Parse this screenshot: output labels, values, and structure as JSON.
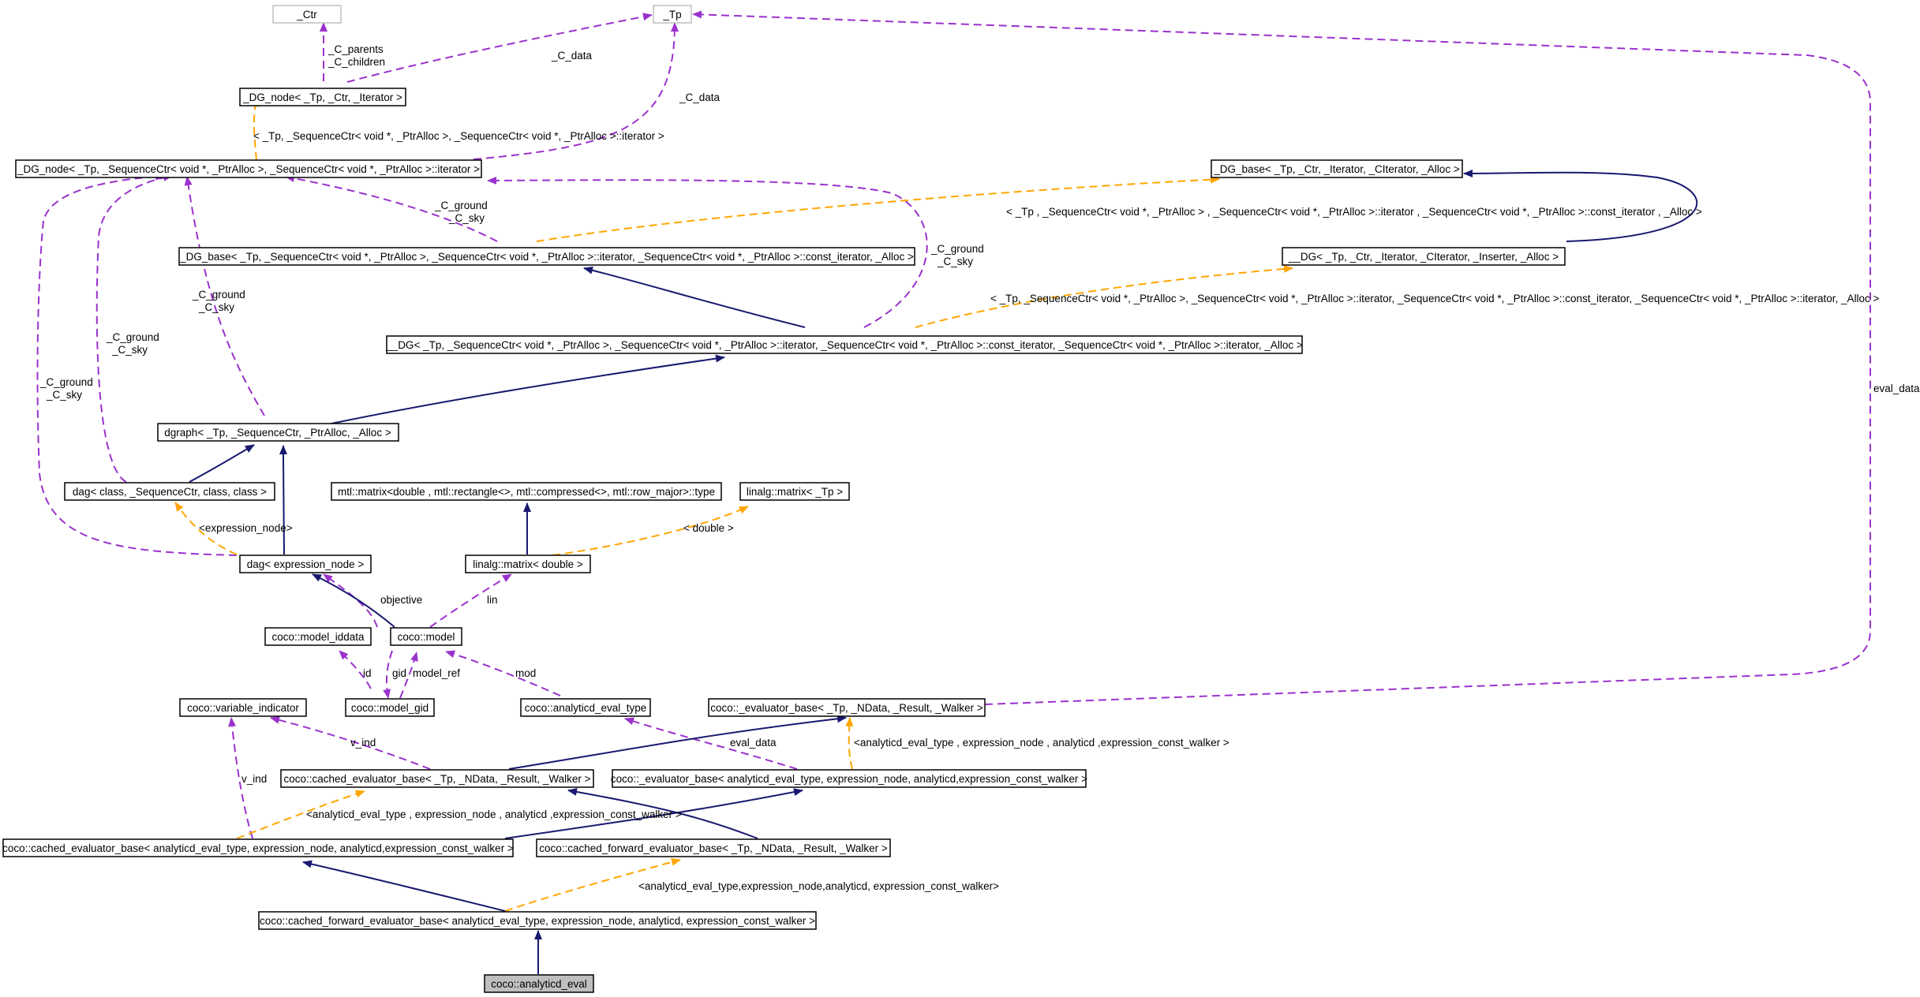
{
  "nodes": {
    "ctr": "_Ctr",
    "tp": "_Tp",
    "dg_node_generic": "_DG_node< _Tp, _Ctr, _Iterator >",
    "dg_node_inst": "_DG_node< _Tp, _SequenceCtr< void *, _PtrAlloc >, _SequenceCtr< void *, _PtrAlloc >::iterator >",
    "dg_base_generic": "_DG_base< _Tp, _Ctr, _Iterator, _CIterator, _Alloc >",
    "dg_base_inst": "_DG_base< _Tp, _SequenceCtr< void *, _PtrAlloc >, _SequenceCtr< void *, _PtrAlloc >::iterator, _SequenceCtr< void *, _PtrAlloc >::const_iterator, _Alloc >",
    "dg_generic": "__DG< _Tp, _Ctr, _Iterator, _CIterator, _Inserter, _Alloc >",
    "dg_inst": "__DG< _Tp, _SequenceCtr< void *, _PtrAlloc >, _SequenceCtr< void *, _PtrAlloc >::iterator, _SequenceCtr< void *, _PtrAlloc >::const_iterator, _SequenceCtr< void *, _PtrAlloc >::iterator, _Alloc >",
    "dgraph": "dgraph< _Tp, _SequenceCtr, _PtrAlloc, _Alloc >",
    "dag_generic": "dag< class, _SequenceCtr, class, class >",
    "dag_expr": "dag< expression_node >",
    "mtl_matrix": "mtl::matrix<double , mtl::rectangle<>, mtl::compressed<>, mtl::row_major>::type",
    "linalg_matrix_tp": "linalg::matrix< _Tp >",
    "linalg_matrix_double": "linalg::matrix< double >",
    "model_iddata": "coco::model_iddata",
    "model": "coco::model",
    "model_gid": "coco::model_gid",
    "analyticd_eval_type": "coco::analyticd_eval_type",
    "evaluator_base_generic": "coco::_evaluator_base< _Tp, _NData, _Result, _Walker >",
    "variable_indicator": "coco::variable_indicator",
    "cached_evaluator_base_generic": "coco::cached_evaluator_base< _Tp, _NData, _Result, _Walker >",
    "evaluator_base_inst": "coco::_evaluator_base< analyticd_eval_type, expression_node, analyticd,expression_const_walker >",
    "cached_evaluator_base_inst": "coco::cached_evaluator_base< analyticd_eval_type, expression_node, analyticd,expression_const_walker >",
    "cached_forward_generic": "coco::cached_forward_evaluator_base< _Tp, _NData, _Result, _Walker >",
    "cached_forward_inst": "coco::cached_forward_evaluator_base< analyticd_eval_type, expression_node, analyticd, expression_const_walker >",
    "analyticd_eval": "coco::analyticd_eval"
  },
  "edge_labels": {
    "c_parents": "_C_parents",
    "c_children": "_C_children",
    "c_data_1": "_C_data",
    "c_data_2": "_C_data",
    "tpl_dg_node": "< _Tp, _SequenceCtr< void *, _PtrAlloc >, _SequenceCtr< void *, _PtrAlloc >::iterator >",
    "tpl_dg_base": "< _Tp , _SequenceCtr< void *, _PtrAlloc > , _SequenceCtr< void *, _PtrAlloc >::iterator , _SequenceCtr< void *, _PtrAlloc >::const_iterator , _Alloc  >",
    "tpl_dg": "< _Tp, _SequenceCtr< void *, _PtrAlloc >, _SequenceCtr< void *, _PtrAlloc >::iterator, _SequenceCtr< void *, _PtrAlloc >::const_iterator, _SequenceCtr< void *, _PtrAlloc >::iterator, _Alloc >",
    "ground_sky_a1": "_C_ground",
    "ground_sky_a2": "_C_sky",
    "ground_sky_b1": "_C_ground",
    "ground_sky_b2": "_C_sky",
    "ground_sky_c1": "_C_ground",
    "ground_sky_c2": "_C_sky",
    "ground_sky_d1": "_C_ground",
    "ground_sky_d2": "_C_sky",
    "ground_sky_e1": "_C_ground",
    "ground_sky_e2": "_C_sky",
    "eval_data_right": "eval_data",
    "tpl_expression_node": "<expression_node>",
    "tpl_double": "< double >",
    "objective": "objective",
    "lin": "lin",
    "id": "id",
    "gid": "gid",
    "model_ref": "model_ref",
    "mod": "mod",
    "v_ind_1": "v_ind",
    "v_ind_2": "v_ind",
    "eval_data_mid": "eval_data",
    "tpl_analyticd_1": "<analyticd_eval_type , expression_node , analyticd ,expression_const_walker >",
    "tpl_analyticd_2": "<analyticd_eval_type , expression_node , analyticd ,expression_const_walker >",
    "tpl_analyticd_3": "<analyticd_eval_type,expression_node,analyticd, expression_const_walker>"
  },
  "colors": {
    "inheritance": "#191970",
    "usage": "#9a32cd",
    "template": "#ffa500",
    "highlight_fill": "#bfbfbf",
    "undocumented_border": "#bfbfbf"
  }
}
